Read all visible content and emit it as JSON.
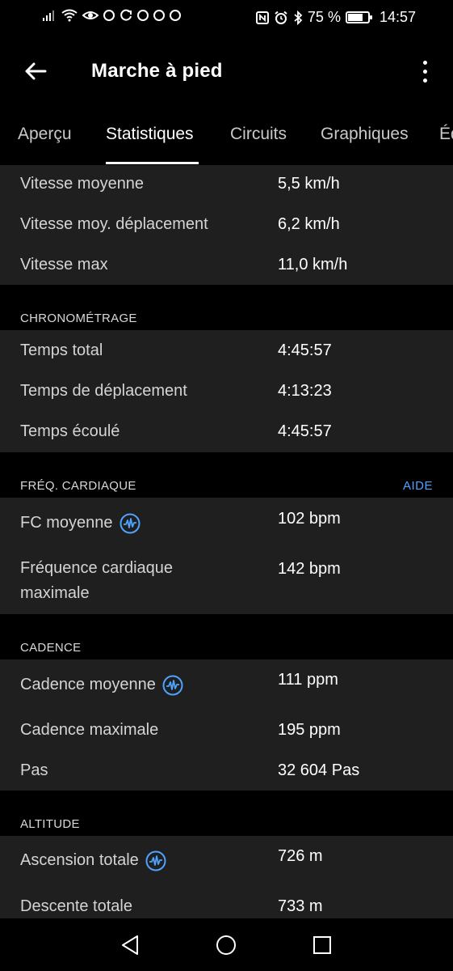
{
  "status_bar": {
    "battery_percent": "75 %",
    "time": "14:57",
    "battery_level": 0.75,
    "icons": [
      "signal-icon",
      "wifi-icon",
      "eye-icon",
      "pinterest-icon",
      "sync-icon",
      "pinterest-icon",
      "pinterest-icon",
      "pinterest-icon",
      "nfc-icon",
      "alarm-icon",
      "bluetooth-icon",
      "battery-icon"
    ]
  },
  "app_bar": {
    "title": "Marche à pied",
    "back_icon": "arrow-left-icon",
    "menu_icon": "more-vertical-icon"
  },
  "tabs": [
    {
      "label": "Aperçu",
      "active": false
    },
    {
      "label": "Statistiques",
      "active": true
    },
    {
      "label": "Circuits",
      "active": false
    },
    {
      "label": "Graphiques",
      "active": false
    },
    {
      "label": "Éq",
      "active": false
    }
  ],
  "speed": {
    "rows": [
      {
        "label": "Vitesse moyenne",
        "value": "5,5 km/h"
      },
      {
        "label": "Vitesse moy. déplacement",
        "value": "6,2 km/h"
      },
      {
        "label": "Vitesse max",
        "value": "11,0 km/h"
      }
    ]
  },
  "timing": {
    "header": "CHRONOMÉTRAGE",
    "rows": [
      {
        "label": "Temps total",
        "value": "4:45:57"
      },
      {
        "label": "Temps de déplacement",
        "value": "4:13:23"
      },
      {
        "label": "Temps écoulé",
        "value": "4:45:57"
      }
    ]
  },
  "heart_rate": {
    "header": "FRÉQ. CARDIAQUE",
    "help": "AIDE",
    "rows": [
      {
        "label": "FC moyenne",
        "value": "102 bpm",
        "icon": "heart-rate-wave-icon"
      },
      {
        "label_line1": "Fréquence cardiaque",
        "label_line2": "maximale",
        "value": "142 bpm"
      }
    ]
  },
  "cadence": {
    "header": "CADENCE",
    "rows": [
      {
        "label": "Cadence moyenne",
        "value": "111 ppm",
        "icon": "heart-rate-wave-icon"
      },
      {
        "label": "Cadence maximale",
        "value": "195 ppm"
      },
      {
        "label": "Pas",
        "value": "32 604 Pas"
      }
    ]
  },
  "altitude": {
    "header": "ALTITUDE",
    "rows": [
      {
        "label": "Ascension totale",
        "value": "726 m",
        "icon": "heart-rate-wave-icon"
      },
      {
        "label": "Descente totale",
        "value": "733 m"
      }
    ]
  },
  "colors": {
    "background": "#000000",
    "card": "#1f1f1f",
    "accent": "#4fa3ff"
  },
  "nav_bar": {
    "icons": [
      "back-triangle-icon",
      "home-circle-icon",
      "recents-square-icon"
    ]
  }
}
